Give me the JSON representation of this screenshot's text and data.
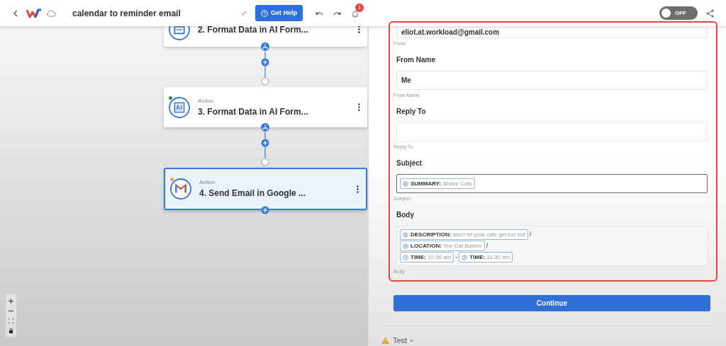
{
  "header": {
    "title": "calendar to reminder email",
    "help_button": "Get Help",
    "notification_count": "1",
    "toggle": {
      "label": "OFF",
      "on": false
    }
  },
  "nodes": [
    {
      "title": "2. Format Data in AI Form...",
      "selected": false
    },
    {
      "step_type": "Action",
      "title": "3. Format Data in AI Form...",
      "selected": false,
      "color": "#2e8b3a"
    },
    {
      "step_type": "Action",
      "title": "4. Send Email in Google ...",
      "selected": true,
      "color": "#f0a830"
    }
  ],
  "form": {
    "fields": [
      {
        "kind": "text",
        "value": "eliot.at.workload@gmail.com",
        "helper": "From",
        "focused": false
      },
      {
        "kind": "text",
        "label": "From Name",
        "value": "Me",
        "helper": "From Name",
        "focused": false
      },
      {
        "kind": "text",
        "label": "Reply To",
        "helper": "Reply To",
        "focused": false
      },
      {
        "kind": "tokens",
        "label": "Subject",
        "lines": [
          [
            {
              "kind": "token",
              "key": "SUMMARY:",
              "value": "Shave Cats"
            }
          ]
        ],
        "helper": "Subject",
        "focused": true
      },
      {
        "kind": "tokens",
        "label": "Body",
        "lines": [
          [
            {
              "kind": "token",
              "key": "DESCRIPTION:",
              "value": "don't let your cats get too hot"
            },
            {
              "kind": "text",
              "text": "/"
            }
          ],
          [
            {
              "kind": "token",
              "key": "LOCATION:",
              "value": "The Cat Barber"
            },
            {
              "kind": "text",
              "text": "/"
            }
          ],
          [
            {
              "kind": "time",
              "key": "TIME:",
              "value": "10:30 am"
            },
            {
              "kind": "text",
              "text": "-"
            },
            {
              "kind": "time",
              "key": "TIME:",
              "value": "11:30 am"
            }
          ]
        ],
        "helper": "Body",
        "focused": false
      }
    ]
  },
  "continue_button": "Continue",
  "test_section": {
    "label": "Test",
    "expanded": false
  }
}
